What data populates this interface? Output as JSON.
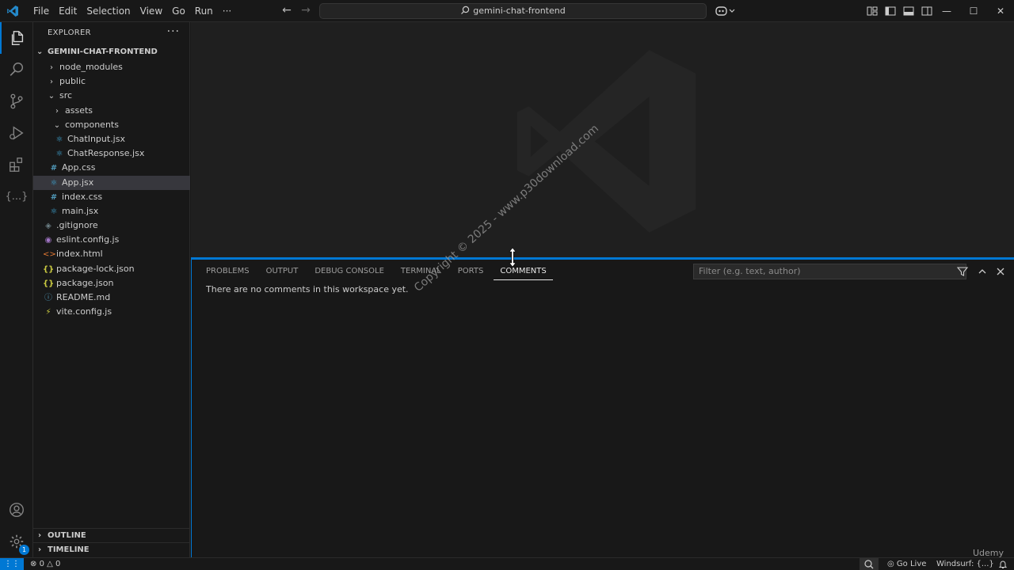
{
  "titlebar": {
    "menu": [
      "File",
      "Edit",
      "Selection",
      "View",
      "Go",
      "Run",
      "···"
    ],
    "search_text": "gemini-chat-frontend"
  },
  "sidebar": {
    "title": "EXPLORER",
    "more": "···",
    "folder": "GEMINI-CHAT-FRONTEND",
    "items": [
      {
        "label": "node_modules",
        "icon": "chevron-right",
        "indent": 0
      },
      {
        "label": "public",
        "icon": "chevron-right",
        "indent": 0
      },
      {
        "label": "src",
        "icon": "chevron-down",
        "indent": 0
      },
      {
        "label": "assets",
        "icon": "chevron-right",
        "indent": 1
      },
      {
        "label": "components",
        "icon": "chevron-down",
        "indent": 1
      },
      {
        "label": "ChatInput.jsx",
        "icon": "react",
        "indent": 2
      },
      {
        "label": "ChatResponse.jsx",
        "icon": "react",
        "indent": 2
      },
      {
        "label": "App.css",
        "icon": "hash",
        "indent": 1
      },
      {
        "label": "App.jsx",
        "icon": "react",
        "indent": 1,
        "selected": true
      },
      {
        "label": "index.css",
        "icon": "hash",
        "indent": 1
      },
      {
        "label": "main.jsx",
        "icon": "react",
        "indent": 1
      },
      {
        "label": ".gitignore",
        "icon": "git",
        "indent": 0
      },
      {
        "label": "eslint.config.js",
        "icon": "eslint",
        "indent": 0
      },
      {
        "label": "index.html",
        "icon": "html",
        "indent": 0
      },
      {
        "label": "package-lock.json",
        "icon": "json",
        "indent": 0
      },
      {
        "label": "package.json",
        "icon": "json",
        "indent": 0
      },
      {
        "label": "README.md",
        "icon": "info",
        "indent": 0
      },
      {
        "label": "vite.config.js",
        "icon": "vite",
        "indent": 0
      }
    ],
    "outline": "OUTLINE",
    "timeline": "TIMELINE"
  },
  "panel": {
    "tabs": [
      "PROBLEMS",
      "OUTPUT",
      "DEBUG CONSOLE",
      "TERMINAL",
      "PORTS",
      "COMMENTS"
    ],
    "active_tab": "COMMENTS",
    "filter_placeholder": "Filter (e.g. text, author)",
    "empty_message": "There are no comments in this workspace yet."
  },
  "watermark": "Copyright © 2025 - www.p30download.com",
  "status": {
    "errors": "0",
    "warnings": "0",
    "go_live": "Go Live",
    "windsurf": "Windsurf: {...}",
    "accounts_badge": "1",
    "udemy": "Udemy"
  },
  "colors": {
    "accent": "#0078d4",
    "background": "#181818",
    "editor": "#1f1f1f"
  }
}
